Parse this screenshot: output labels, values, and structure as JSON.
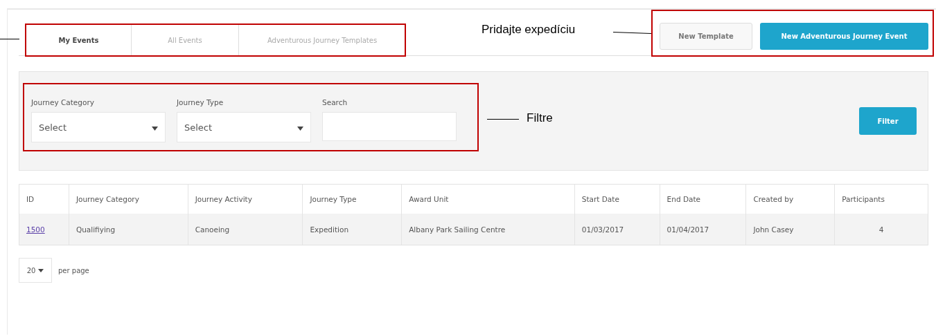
{
  "tabs": [
    {
      "label": "My Events",
      "selected": true
    },
    {
      "label": "All Events",
      "selected": false
    },
    {
      "label": "Adventurous Journey Templates",
      "selected": false
    }
  ],
  "actions": [
    {
      "label": "New Template",
      "kind": "secondary"
    },
    {
      "label": "New Adventurous Journey Event",
      "kind": "primary"
    }
  ],
  "filters": [
    {
      "label": "Journey Category",
      "kind": "select",
      "value": "Select"
    },
    {
      "label": "Journey Type",
      "kind": "select",
      "value": "Select"
    },
    {
      "label": "Search",
      "kind": "text"
    }
  ],
  "filter_button": "Filter",
  "table": {
    "columns": [
      {
        "label": "ID",
        "kind": "link"
      },
      {
        "label": "Journey Category",
        "kind": "text"
      },
      {
        "label": "Journey Activity",
        "kind": "text"
      },
      {
        "label": "Journey Type",
        "kind": "text"
      },
      {
        "label": "Award Unit",
        "kind": "text"
      },
      {
        "label": "Start Date",
        "kind": "text"
      },
      {
        "label": "End Date",
        "kind": "text"
      },
      {
        "label": "Created by",
        "kind": "text"
      },
      {
        "label": "Participants",
        "kind": "number"
      }
    ],
    "rows": [
      [
        "1500",
        "Qualifiying",
        "Canoeing",
        "Expedition",
        "Albany Park Sailing Centre",
        "01/03/2017",
        "01/04/2017",
        "John Casey",
        "4"
      ]
    ]
  },
  "pagination": {
    "per_page": "20",
    "label": "per page"
  },
  "annotations": [
    {
      "label": "Pridajte expedíciu"
    },
    {
      "label": "Filtre"
    }
  ]
}
